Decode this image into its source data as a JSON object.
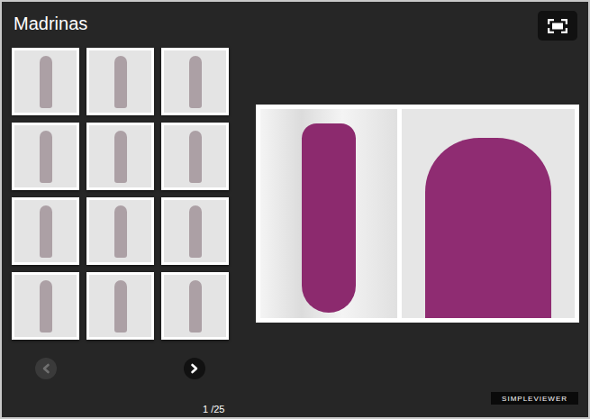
{
  "gallery": {
    "title": "Madrinas"
  },
  "navigation": {
    "prev": {
      "disabled": true
    },
    "next": {
      "disabled": false
    }
  },
  "counter": "1 /25",
  "badge": "SIMPLEVIEWER"
}
